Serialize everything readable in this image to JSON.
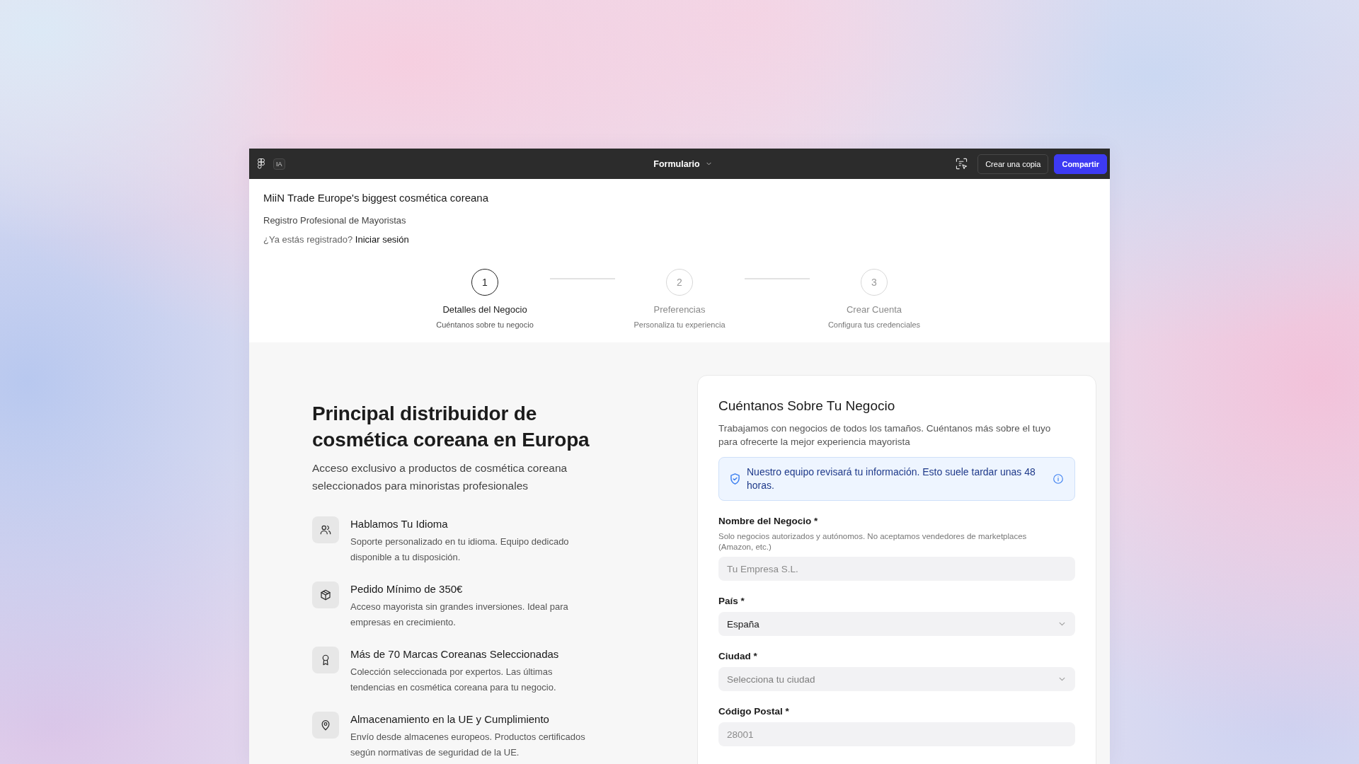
{
  "toolbar": {
    "badge": "IA",
    "title": "Formulario",
    "buttons": [
      {
        "label": "Crear una copia",
        "kind": "copy"
      },
      {
        "label": "Compartir",
        "kind": "share"
      }
    ]
  },
  "header": {
    "title": "MiiN Trade Europe's biggest cosmética coreana",
    "subtitle": "Registro Profesional de Mayoristas",
    "login_prompt": "¿Ya estás registrado?",
    "login_link": "Iniciar sesión"
  },
  "steps": [
    {
      "number": "1",
      "label": "Detalles del Negocio",
      "description": "Cuéntanos sobre tu negocio",
      "selected": true
    },
    {
      "number": "2",
      "label": "Preferencias",
      "description": "Personaliza tu experiencia",
      "selected": false
    },
    {
      "number": "3",
      "label": "Crear Cuenta",
      "description": "Configura tus credenciales",
      "selected": false
    }
  ],
  "hero": {
    "heading": "Principal distribuidor de cosmética coreana en Europa",
    "text": "Acceso exclusivo a productos de cosmética coreana seleccionados para minoristas profesionales"
  },
  "features": [
    {
      "kind": "language",
      "title": "Hablamos Tu Idioma",
      "text": "Soporte personalizado en tu idioma. Equipo dedicado disponible a tu disposición."
    },
    {
      "kind": "order",
      "title": "Pedido Mínimo de 350€",
      "text": "Acceso mayorista sin grandes inversiones. Ideal para empresas en crecimiento."
    },
    {
      "kind": "brands",
      "title": "Más de 70 Marcas Coreanas Seleccionadas",
      "text": "Colección seleccionada por expertos. Las últimas tendencias en cosmética coreana para tu negocio."
    },
    {
      "kind": "storage",
      "title": "Almacenamiento en la UE y Cumplimiento",
      "text": "Envío desde almacenes europeos. Productos certificados según normativas de seguridad de la UE."
    }
  ],
  "form": {
    "title": "Cuéntanos Sobre Tu Negocio",
    "description": "Trabajamos con negocios de todos los tamaños. Cuéntanos más sobre el tuyo para ofrecerte la mejor experiencia mayorista",
    "notice": "Nuestro equipo revisará tu información. Esto suele tardar unas 48 horas.",
    "fields": [
      {
        "kind": "text",
        "label": "Nombre del Negocio *",
        "hint": "Solo negocios autorizados y autónomos. No aceptamos vendedores de marketplaces (Amazon, etc.)",
        "placeholder": "Tu Empresa S.L."
      },
      {
        "kind": "select",
        "label": "País *",
        "value": "España"
      },
      {
        "kind": "select",
        "label": "Ciudad *",
        "placeholder": "Selecciona tu ciudad"
      },
      {
        "kind": "text",
        "label": "Código Postal *",
        "placeholder": "28001"
      }
    ]
  }
}
